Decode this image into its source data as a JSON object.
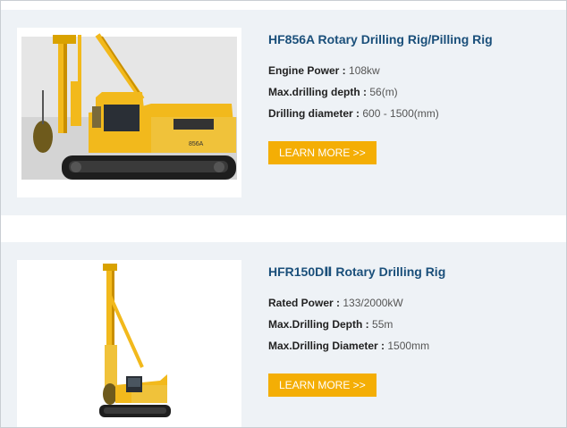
{
  "products": [
    {
      "title": "HF856A Rotary Drilling Rig/Pilling Rig",
      "image_icon": "rotary-drilling-rig-photo",
      "model_mark": "856A",
      "specs": [
        {
          "label": "Engine Power :",
          "value": "108kw"
        },
        {
          "label": "Max.drilling depth :",
          "value": "56(m)"
        },
        {
          "label": "Drilling diameter :",
          "value": "600 - 1500(mm)"
        }
      ],
      "button_label": "LEARN MORE >>"
    },
    {
      "title": "HFR150DⅡ Rotary Drilling Rig",
      "image_icon": "rotary-drilling-rig-photo",
      "specs": [
        {
          "label": "Rated Power :",
          "value": "133/2000kW"
        },
        {
          "label": "Max.Drilling Depth :",
          "value": "55m"
        },
        {
          "label": "Max.Drilling Diameter :",
          "value": "1500mm"
        }
      ],
      "button_label": "LEARN MORE >>"
    }
  ],
  "colors": {
    "accent": "#f4ae05",
    "title": "#1a4f7a",
    "card_bg": "#eef2f6",
    "machine_yellow": "#f2b91c"
  }
}
